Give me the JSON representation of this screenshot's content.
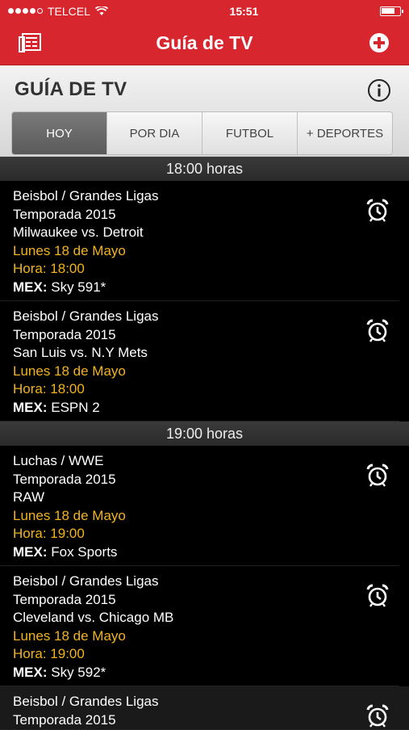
{
  "statusbar": {
    "carrier": "TELCEL",
    "time": "15:51"
  },
  "navbar": {
    "title": "Guía de TV",
    "left_icon": "guide-icon",
    "right_icon": "add-icon"
  },
  "section": {
    "title": "GUÍA DE TV",
    "info_icon": "info-icon"
  },
  "tabs": [
    {
      "label": "HOY",
      "active": true
    },
    {
      "label": "POR DIA",
      "active": false
    },
    {
      "label": "FUTBOL",
      "active": false
    },
    {
      "label": "+ DEPORTES",
      "active": false
    }
  ],
  "groups": [
    {
      "hour": "18:00 horas",
      "events": [
        {
          "sport": "Beisbol / Grandes Ligas",
          "season": "Temporada 2015",
          "match": "Milwaukee vs. Detroit",
          "date": "Lunes 18 de Mayo",
          "time": "Hora: 18:00",
          "chan_label": "MEX:",
          "chan": "Sky 591*"
        },
        {
          "sport": "Beisbol / Grandes Ligas",
          "season": "Temporada 2015",
          "match": "San Luis vs. N.Y Mets",
          "date": "Lunes 18 de Mayo",
          "time": "Hora: 18:00",
          "chan_label": "MEX:",
          "chan": "ESPN 2"
        }
      ]
    },
    {
      "hour": "19:00 horas",
      "events": [
        {
          "sport": "Luchas / WWE",
          "season": "Temporada 2015",
          "match": "RAW",
          "date": "Lunes 18 de Mayo",
          "time": "Hora: 19:00",
          "chan_label": "MEX:",
          "chan": "Fox Sports"
        },
        {
          "sport": "Beisbol / Grandes Ligas",
          "season": "Temporada 2015",
          "match": "Cleveland vs. Chicago MB",
          "date": "Lunes 18 de Mayo",
          "time": "Hora: 19:00",
          "chan_label": "MEX:",
          "chan": "Sky 592*"
        },
        {
          "sport": "Beisbol / Grandes Ligas",
          "season": "Temporada 2015"
        }
      ]
    }
  ],
  "colors": {
    "brand_red": "#d7262e",
    "date_yellow": "#f2b31d"
  }
}
